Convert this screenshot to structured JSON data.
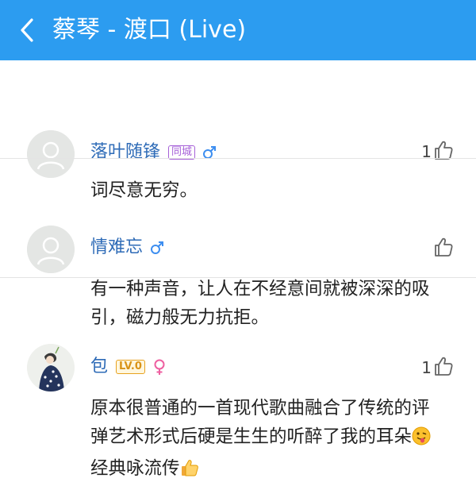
{
  "header": {
    "title": "蔡琴 - 渡口 (Live)",
    "background": "#2c9cf0"
  },
  "comments": [
    {
      "username": "落叶随锋",
      "tag": "同城",
      "gender": "male",
      "likes": "1",
      "text": "词尽意无穷。"
    },
    {
      "username": "情难忘",
      "gender": "male",
      "likes": "",
      "text_line1": "有一种声音，让人在不经意间就被深深的吸",
      "text_line2": "引，磁力般无力抗拒。"
    },
    {
      "username": "包",
      "tag": "LV.0",
      "gender": "female",
      "likes": "1",
      "text_line1": "原本很普通的一首现代歌曲融合了传统的评",
      "text_line2": "弹艺术形式后硬是生生的听醉了我的耳朵",
      "text_line3": "经典咏流传",
      "emojis": [
        "tongue-out-emoji",
        "thumbs-up-emoji"
      ]
    }
  ]
}
